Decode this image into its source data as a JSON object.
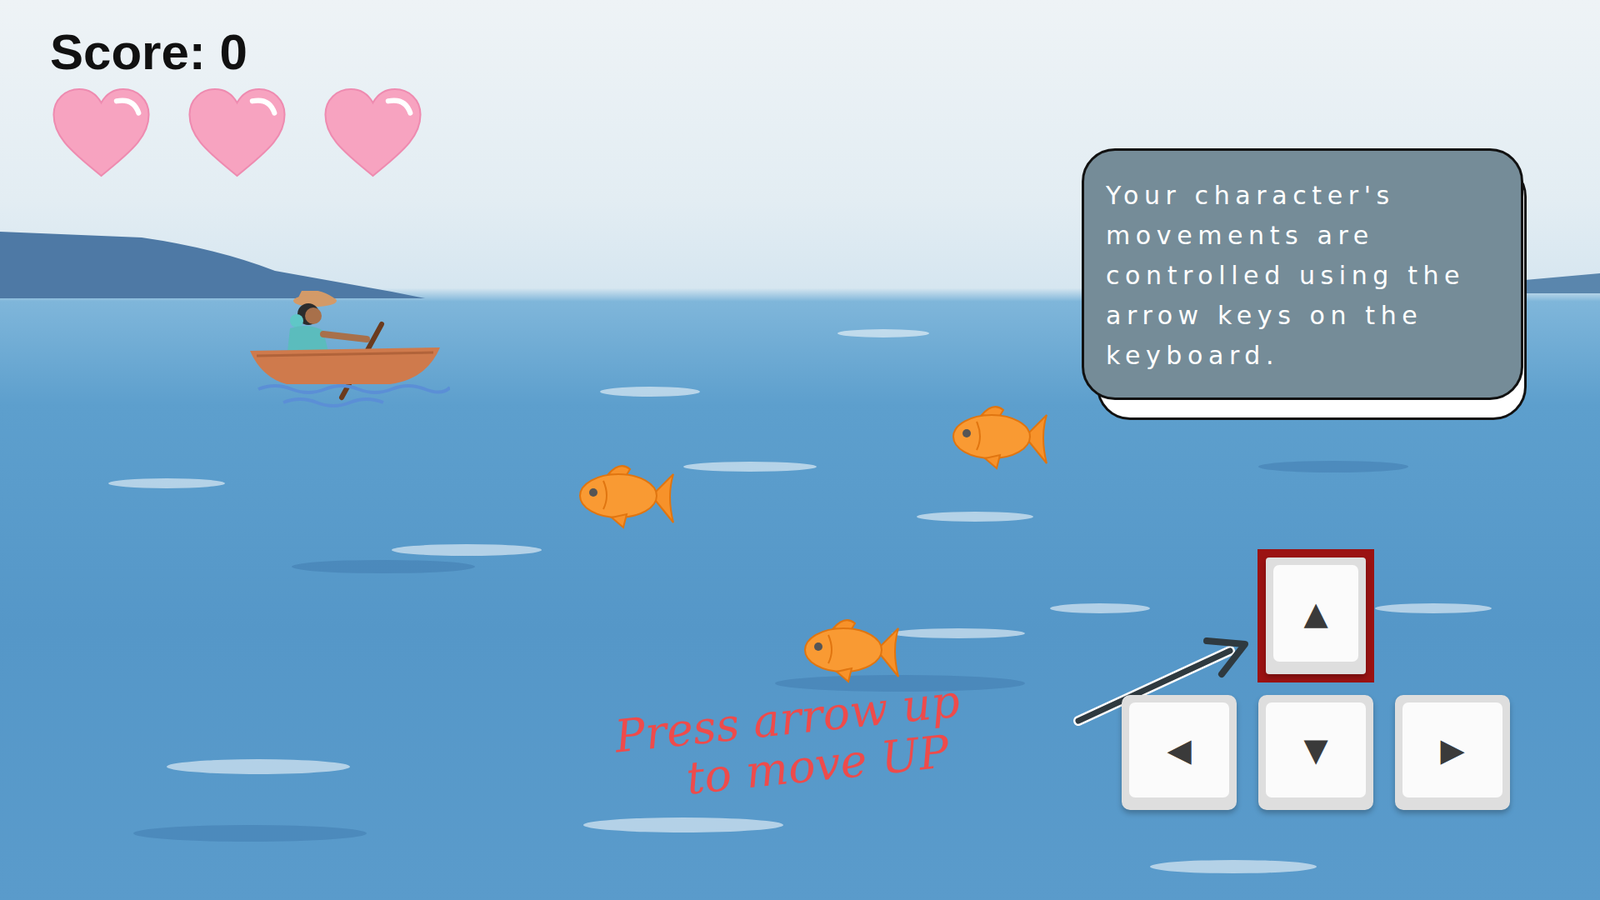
{
  "hud": {
    "score": "Score: 0",
    "lives": [
      {
        "full": true
      },
      {
        "full": true
      },
      {
        "full": true
      }
    ]
  },
  "tip": {
    "text": "Your character's movements are controlled using the arrow keys on the keyboard."
  },
  "keys": [
    {
      "label": "▲",
      "selected": true
    },
    {
      "label": "◀",
      "selected": false
    },
    {
      "label": "▼",
      "selected": false
    },
    {
      "label": "▶",
      "selected": false
    }
  ],
  "hint": {
    "lines": [
      "Press arrow up",
      "to move UP"
    ]
  }
}
